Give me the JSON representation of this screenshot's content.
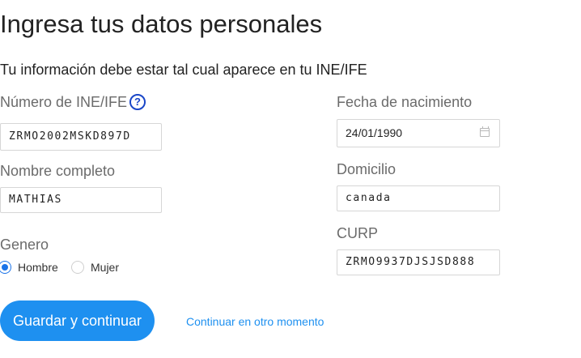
{
  "header": {
    "title": "Ingresa tus datos personales",
    "subtitle": "Tu información debe estar tal cual aparece en tu INE/IFE"
  },
  "form": {
    "ine": {
      "label": "Número de INE/IFE",
      "value": "ZRMO2002MSKD897D",
      "help_icon": "question-circle-icon"
    },
    "nombre": {
      "label": "Nombre completo",
      "value": "MATHIAS"
    },
    "genero": {
      "label": "Genero",
      "options": [
        "Hombre",
        "Mujer"
      ],
      "selected": "Hombre"
    },
    "fecha": {
      "label": "Fecha de nacimiento",
      "value": "24/01/1990",
      "icon": "calendar-icon"
    },
    "domicilio": {
      "label": "Domicilio",
      "value": "canada"
    },
    "curp": {
      "label": "CURP",
      "value": "ZRMO9937DJSJSD888"
    }
  },
  "actions": {
    "primary_label": "Guardar y continuar",
    "secondary_label": "Continuar en otro momento"
  },
  "colors": {
    "accent": "#1e90f0",
    "help_icon": "#1a46c8",
    "label": "#6b6b6b"
  }
}
